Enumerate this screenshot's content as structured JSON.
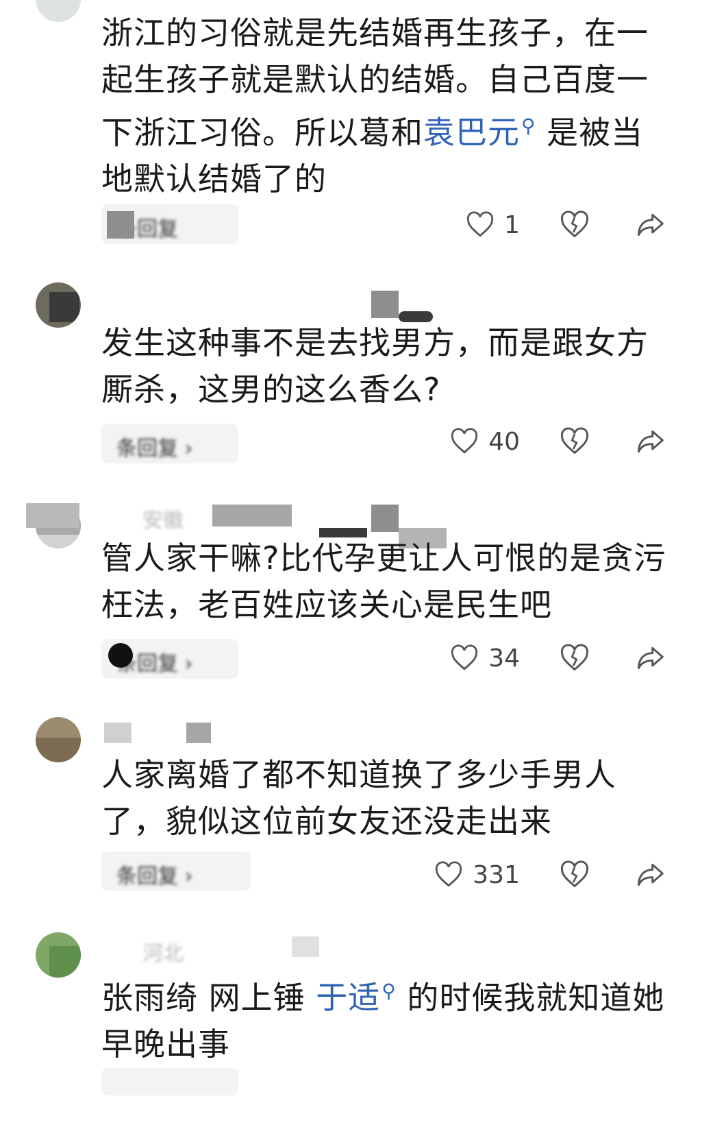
{
  "comments": [
    {
      "meta": "",
      "location": "",
      "text_parts": [
        "浙江的习俗就是先结婚再生孩子，在一起生孩子就是默认的结婚。自己百度一下浙江习俗。所以葛和",
        "袁巴元",
        "是被当地默认结婚了的"
      ],
      "reply_label": "条回复",
      "likes": "1"
    },
    {
      "meta": "",
      "location": "",
      "text": "发生这种事不是去找男方，而是跟女方厮杀，这男的这么香么?",
      "reply_label": "条回复 ›",
      "likes": "40"
    },
    {
      "meta": "",
      "location": "安徽",
      "text": "管人家干嘛?比代孕更让人可恨的是贪污枉法，老百姓应该关心是民生吧",
      "reply_label": "条回复 ›",
      "likes": "34"
    },
    {
      "meta": "",
      "location": "",
      "text": "人家离婚了都不知道换了多少手男人了，貌似这位前女友还没走出来",
      "reply_label": "条回复 ›",
      "likes": "331"
    },
    {
      "meta": "",
      "location": "河北",
      "text_parts": [
        "张雨绮 网上锤 ",
        "于适",
        " 的时候我就知道她早晚出事"
      ],
      "reply_label": "",
      "likes": ""
    }
  ],
  "icons": {
    "like": "heart-outline-icon",
    "dislike": "broken-heart-icon",
    "share": "share-arrow-icon",
    "search_link": "magnifier-icon"
  },
  "colors": {
    "link": "#2d63b7",
    "text": "#1a1a1a",
    "pill": "#f3f3f3"
  }
}
